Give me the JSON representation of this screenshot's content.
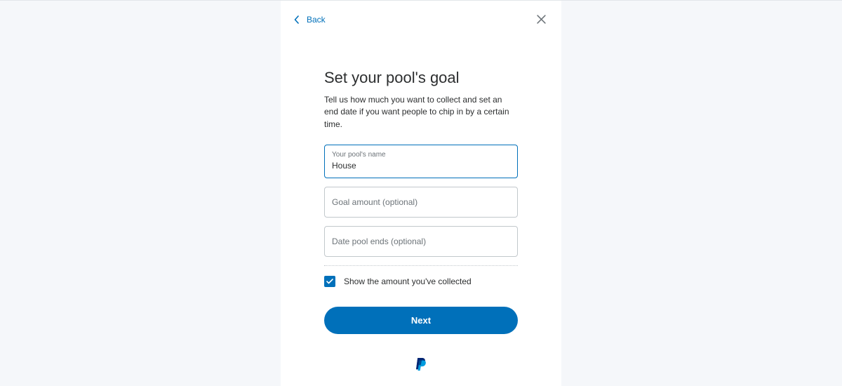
{
  "topbar": {
    "back_label": "Back"
  },
  "header": {
    "title": "Set your pool's goal",
    "subtitle": "Tell us how much you want to collect and set an end date if you want people to chip in by a certain time."
  },
  "fields": {
    "pool_name": {
      "label": "Your pool's name",
      "value": "House"
    },
    "goal_amount": {
      "placeholder": "Goal amount (optional)",
      "value": ""
    },
    "end_date": {
      "placeholder": "Date pool ends (optional)",
      "value": ""
    }
  },
  "checkbox": {
    "label": "Show the amount you've collected",
    "checked": true
  },
  "buttons": {
    "next": "Next"
  }
}
